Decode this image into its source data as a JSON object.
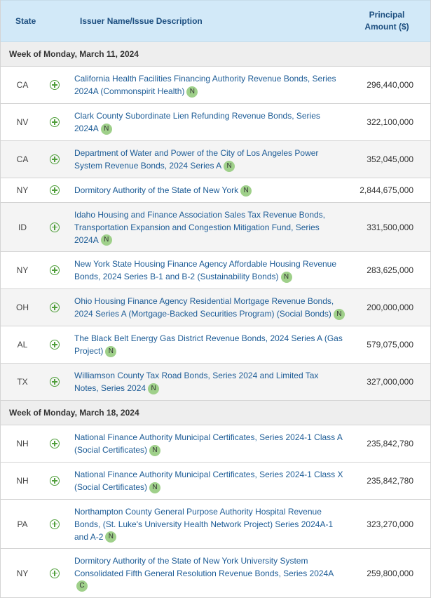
{
  "header": {
    "state": "State",
    "issuer": "Issuer Name/Issue Description",
    "amount_line1": "Principal",
    "amount_line2": "Amount ($)"
  },
  "weeks": [
    {
      "label": "Week of Monday, March 11, 2024",
      "rows": [
        {
          "state": "CA",
          "desc": "California Health Facilities Financing Authority Revenue Bonds, Series 2024A (Commonspirit Health)",
          "badge": "N",
          "amount": "296,440,000"
        },
        {
          "state": "NV",
          "desc": "Clark County Subordinate Lien Refunding Revenue Bonds, Series 2024A",
          "badge": "N",
          "amount": "322,100,000"
        },
        {
          "state": "CA",
          "desc": "Department of Water and Power of the City of Los Angeles Power System Revenue Bonds, 2024 Series A",
          "badge": "N",
          "amount": "352,045,000"
        },
        {
          "state": "NY",
          "desc": "Dormitory Authority of the State of New York",
          "badge": "N",
          "amount": "2,844,675,000"
        },
        {
          "state": "ID",
          "desc": "Idaho Housing and Finance Association Sales Tax Revenue Bonds, Transportation Expansion and Congestion Mitigation Fund, Series 2024A",
          "badge": "N",
          "amount": "331,500,000"
        },
        {
          "state": "NY",
          "desc": "New York State Housing Finance Agency Affordable Housing Revenue Bonds, 2024 Series B-1 and B-2 (Sustainability Bonds)",
          "badge": "N",
          "amount": "283,625,000"
        },
        {
          "state": "OH",
          "desc": "Ohio Housing Finance Agency Residential Mortgage Revenue Bonds, 2024 Series A (Mortgage-Backed Securities Program) (Social Bonds)",
          "badge": "N",
          "amount": "200,000,000"
        },
        {
          "state": "AL",
          "desc": "The Black Belt Energy Gas District Revenue Bonds, 2024 Series A (Gas Project)",
          "badge": "N",
          "amount": "579,075,000"
        },
        {
          "state": "TX",
          "desc": "Williamson County Tax Road Bonds, Series 2024 and Limited Tax Notes, Series 2024",
          "badge": "N",
          "amount": "327,000,000"
        }
      ]
    },
    {
      "label": "Week of Monday, March 18, 2024",
      "rows": [
        {
          "state": "NH",
          "desc": "National Finance Authority Municipal Certificates, Series 2024-1 Class A (Social Certificates)",
          "badge": "N",
          "amount": "235,842,780"
        },
        {
          "state": "NH",
          "desc": "National Finance Authority Municipal Certificates, Series 2024-1 Class X (Social Certificates)",
          "badge": "N",
          "amount": "235,842,780"
        },
        {
          "state": "PA",
          "desc": "Northampton County General Purpose Authority Hospital Revenue Bonds, (St. Luke's University Health Network Project) Series 2024A-1 and A-2",
          "badge": "N",
          "amount": "323,270,000"
        },
        {
          "state": "NY",
          "desc": "Dormitory Authority of the State of New York University System Consolidated Fifth General Resolution Revenue Bonds, Series 2024A",
          "badge": "C",
          "amount": "259,800,000"
        }
      ]
    }
  ]
}
